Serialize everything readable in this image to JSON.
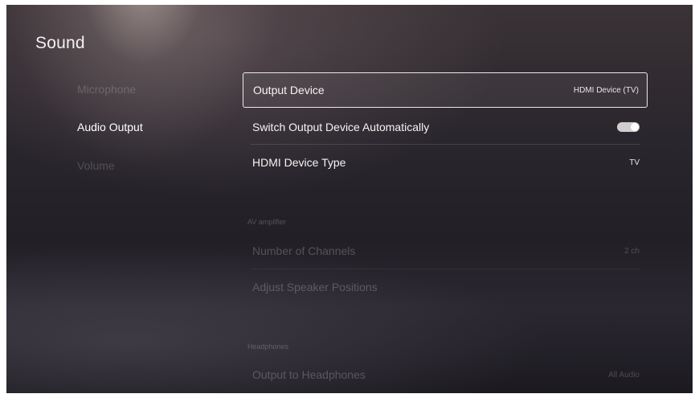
{
  "page": {
    "title": "Sound"
  },
  "sidebar": {
    "items": [
      {
        "label": "Microphone"
      },
      {
        "label": "Audio Output"
      },
      {
        "label": "Volume"
      }
    ]
  },
  "settings": {
    "output_device": {
      "label": "Output Device",
      "value": "HDMI Device (TV)"
    },
    "switch_auto": {
      "label": "Switch Output Device Automatically",
      "enabled": true
    },
    "hdmi_type": {
      "label": "HDMI Device Type",
      "value": "TV"
    },
    "av_amplifier": {
      "heading": "AV amplifier",
      "channels": {
        "label": "Number of Channels",
        "value": "2 ch"
      },
      "speaker_positions": {
        "label": "Adjust Speaker Positions"
      }
    },
    "headphones": {
      "heading": "Headphones",
      "output_to_headphones": {
        "label": "Output to Headphones",
        "value": "All Audio"
      }
    }
  }
}
